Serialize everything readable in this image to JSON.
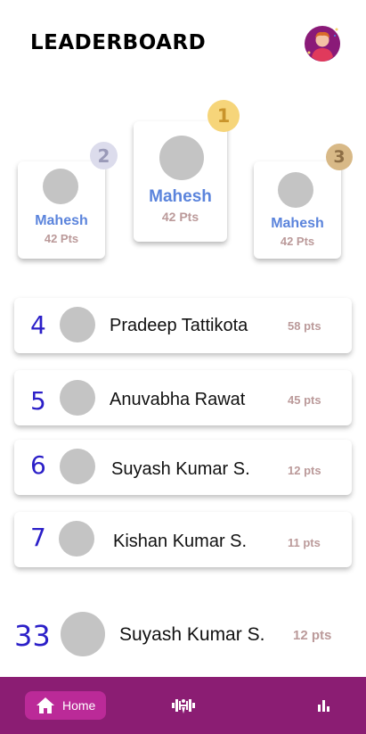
{
  "header": {
    "title": "LEADERBOARD",
    "avatar_icon": "user-avatar-icon"
  },
  "podium": [
    {
      "rank": "1",
      "name": "Mahesh",
      "points": "42 Pts",
      "badge_color": "#f6d57a"
    },
    {
      "rank": "2",
      "name": "Mahesh",
      "points": "42 Pts",
      "badge_color": "#dcdcec"
    },
    {
      "rank": "3",
      "name": "Mahesh",
      "points": "42 Pts",
      "badge_color": "#d8b987"
    }
  ],
  "rows": [
    {
      "rank": "4",
      "name": "Pradeep Tattikota",
      "points": "58 pts"
    },
    {
      "rank": "5",
      "name": "Anuvabha Rawat",
      "points": "45 pts"
    },
    {
      "rank": "6",
      "name": "Suyash Kumar S.",
      "points": "12 pts"
    },
    {
      "rank": "7",
      "name": "Kishan Kumar S.",
      "points": "11 pts"
    }
  ],
  "current_user": {
    "rank": "33",
    "name": "Suyash Kumar S.",
    "points": "12 pts"
  },
  "nav": {
    "home_label": "Home",
    "home_icon": "home-icon",
    "workout_icon": "dumbbell-icon",
    "stats_icon": "bar-chart-icon"
  },
  "colors": {
    "accent_blue": "#5b84dc",
    "rank_blue": "#2b1fc8",
    "points": "#bb9a9a",
    "nav_bg": "#8b1d73",
    "nav_active": "#bb2a98"
  }
}
